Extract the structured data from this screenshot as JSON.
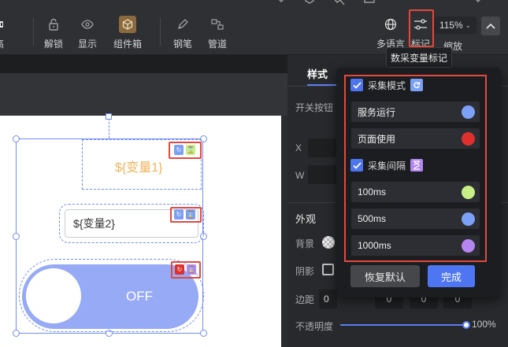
{
  "toolbar": {
    "items": [
      {
        "label": "解锁",
        "icon": "unlock-icon"
      },
      {
        "label": "显示",
        "icon": "eye-icon"
      },
      {
        "label": "组件箱",
        "icon": "cube-icon"
      },
      {
        "label": "钢笔",
        "icon": "pen-icon"
      },
      {
        "label": "管道",
        "icon": "pipe-icon"
      }
    ],
    "left_cut_label": "高",
    "right": {
      "language_label": "多语言",
      "mark_label": "标记",
      "zoom_value": "115%",
      "zoom_label": "缩放"
    }
  },
  "tooltip": "数采变量标记",
  "canvas": {
    "text_var": "${变量1}",
    "input_var": "${变量2}",
    "switch_label": "OFF"
  },
  "right_panel": {
    "active_tab": "样式",
    "switch_label": "开关按钮",
    "x_label": "X",
    "w_label": "W",
    "appearance_label": "外观",
    "background_label": "背景",
    "shadow_label": "阴影",
    "margin_label": "边距",
    "margin_values": [
      "0",
      "0",
      "0",
      "0"
    ],
    "opacity_label": "不透明度",
    "opacity_value": "100%"
  },
  "popup": {
    "mode_label": "采集模式",
    "mode_checked": true,
    "mode_options": [
      {
        "label": "服务运行",
        "color": "#7ba0f5"
      },
      {
        "label": "页面使用",
        "color": "#e0302d"
      }
    ],
    "interval_label": "采集间隔",
    "interval_checked": true,
    "interval_options": [
      {
        "label": "100ms",
        "color": "#c7ef86"
      },
      {
        "label": "500ms",
        "color": "#7ba0f5"
      },
      {
        "label": "1000ms",
        "color": "#b487f0"
      }
    ],
    "reset_label": "恢复默认",
    "done_label": "完成"
  },
  "colors": {
    "accent": "#4f76f2",
    "red_highlight": "#e04a3f",
    "selection": "#6e8cf5",
    "switch_bg": "#97aaf5"
  }
}
